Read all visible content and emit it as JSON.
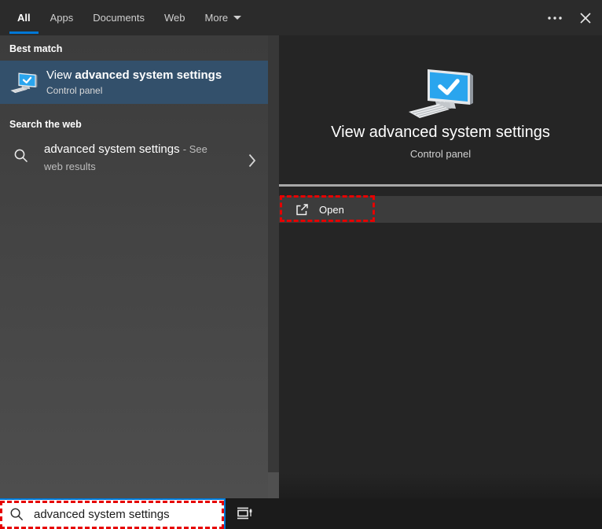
{
  "tabs": {
    "items": [
      {
        "label": "All",
        "active": true
      },
      {
        "label": "Apps",
        "active": false
      },
      {
        "label": "Documents",
        "active": false
      },
      {
        "label": "Web",
        "active": false
      },
      {
        "label": "More",
        "active": false,
        "has_dropdown": true
      }
    ]
  },
  "window_controls": {
    "more_options_icon": "ellipsis",
    "close_icon": "close-x"
  },
  "left_panel": {
    "best_match_header": "Best match",
    "best_match_item": {
      "icon": "control-panel-computer",
      "title_prefix": "View ",
      "title_emphasis": "advanced system settings",
      "subtitle": "Control panel"
    },
    "search_web_header": "Search the web",
    "web_suggestion": {
      "icon": "search",
      "query": "advanced system settings",
      "suffix": "- See web results",
      "chevron_icon": "chevron-right"
    }
  },
  "preview_panel": {
    "icon": "control-panel-computer",
    "title": "View advanced system settings",
    "subtitle": "Control panel",
    "open_item": {
      "icon": "open-external",
      "label": "Open"
    }
  },
  "taskbar": {
    "search_icon": "search",
    "search_value": "advanced system settings",
    "task_view_icon": "task-view"
  },
  "annotations": {
    "color": "#e60000",
    "targets": [
      "open-item",
      "taskbar-search-box"
    ]
  },
  "colors": {
    "accent_blue": "#0078d7",
    "highlight_row": "#33506b",
    "screen_blue": "#2aa5ee",
    "annotation_red": "#e60000"
  }
}
